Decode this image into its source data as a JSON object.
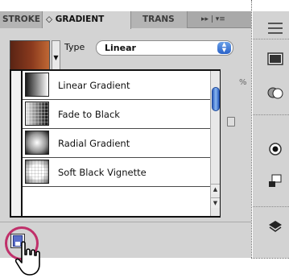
{
  "tabs": {
    "stroke": "STROKE",
    "gradient": "GRADIENT",
    "transparency": "TRANS",
    "gradient_arrow": "◇",
    "controls": "▸▸ | ▾≡"
  },
  "type_row": {
    "label": "Type",
    "value": "Linear",
    "swatch_colors": [
      "#5a2414",
      "#c06834"
    ]
  },
  "background": {
    "percent": "%"
  },
  "presets": [
    {
      "label": "Linear Gradient",
      "icon": "linear-gradient-swatch"
    },
    {
      "label": "Fade to Black",
      "icon": "fade-to-black-swatch"
    },
    {
      "label": "Radial Gradient",
      "icon": "radial-gradient-swatch"
    },
    {
      "label": "Soft Black Vignette",
      "icon": "soft-black-vignette-swatch"
    }
  ],
  "scroll": {
    "up": "▲",
    "down": "▼"
  },
  "colors": {
    "highlight": "#c0306a",
    "scroll_thumb": "#2a62c8"
  }
}
